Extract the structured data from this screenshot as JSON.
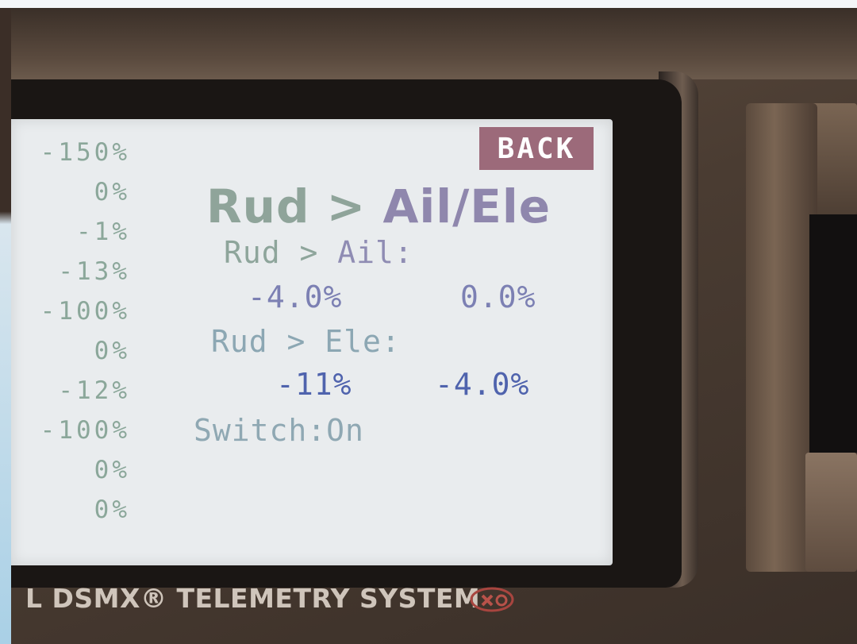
{
  "sidebar_values": [
    "-150%",
    "0%",
    "-1%",
    "-13%",
    "-100%",
    "0%",
    "-12%",
    "-100%",
    "0%",
    "0%"
  ],
  "back_label": "BACK",
  "title": {
    "prefix": "Rud > ",
    "suffix": "Ail/Ele"
  },
  "rud_ail": {
    "prefix": "Rud > ",
    "suffix": "Ail:",
    "value_left": "-4.0%",
    "value_right": "0.0%"
  },
  "rud_ele": {
    "label": "Rud > Ele:",
    "value_left": "-11%",
    "value_right": "-4.0%"
  },
  "switch": {
    "label": "Switch:",
    "value": "On"
  },
  "brand_text": "L DSMX® TELEMETRY SYSTEM",
  "colors": {
    "back_bg": "#9c6a7a",
    "value_blue": "#4f63ad",
    "label_green": "#8ba79a"
  }
}
